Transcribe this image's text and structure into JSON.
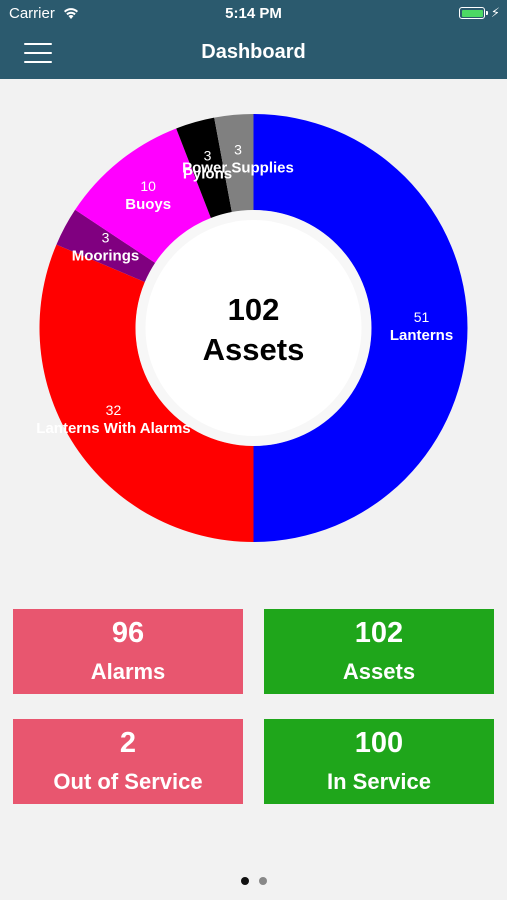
{
  "status_bar": {
    "carrier": "Carrier",
    "time": "5:14 PM",
    "wifi_icon": "wifi-icon",
    "battery_icon": "battery-icon"
  },
  "nav": {
    "title": "Dashboard",
    "menu_icon": "hamburger-menu-icon"
  },
  "chart_data": {
    "type": "pie",
    "center_value": "102",
    "center_label": "Assets",
    "slices": [
      {
        "label": "Lanterns",
        "value": 51,
        "color": "#0000ff"
      },
      {
        "label": "Lanterns With Alarms",
        "value": 32,
        "color": "#ff0000"
      },
      {
        "label": "Moorings",
        "value": 3,
        "color": "#800080"
      },
      {
        "label": "Buoys",
        "value": 10,
        "color": "#ff00ff"
      },
      {
        "label": "Pylons",
        "value": 3,
        "color": "#000000"
      },
      {
        "label": "Power Supplies",
        "value": 3,
        "color": "#808080"
      }
    ]
  },
  "tiles": [
    {
      "value": "96",
      "label": "Alarms",
      "color": "#e8566f"
    },
    {
      "value": "102",
      "label": "Assets",
      "color": "#1fa61b"
    },
    {
      "value": "2",
      "label": "Out of Service",
      "color": "#e8566f"
    },
    {
      "value": "100",
      "label": "In Service",
      "color": "#1fa61b"
    }
  ],
  "pager": {
    "pages": 2,
    "current": 1
  }
}
